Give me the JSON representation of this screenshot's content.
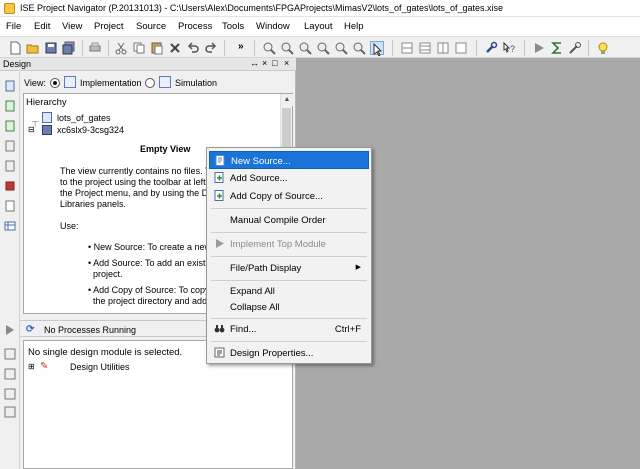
{
  "window": {
    "title": "ISE Project Navigator (P.20131013) - C:\\Users\\Alex\\Documents\\FPGAProjects\\MimasV2\\lots_of_gates\\lots_of_gates.xise"
  },
  "menubar": {
    "items": [
      "File",
      "Edit",
      "View",
      "Project",
      "Source",
      "Process",
      "Tools",
      "Window",
      "Layout",
      "Help"
    ]
  },
  "design_panel": {
    "title": "Design",
    "controls": [
      "↔",
      "×",
      "□",
      "×"
    ],
    "view_label": "View:",
    "view_options": [
      {
        "label": "Implementation",
        "selected": true
      },
      {
        "label": "Simulation",
        "selected": false
      }
    ],
    "hierarchy_label": "Hierarchy",
    "tree": [
      {
        "label": "lots_of_gates",
        "icon": "project-file-icon"
      },
      {
        "label": "xc6slx9-3csg324",
        "icon": "fpga-chip-icon"
      }
    ],
    "empty_view": {
      "heading": "Empty View",
      "lines": [
        "The view currently contains no files. Yo",
        "to the project using the toolbar at left,",
        "the Project menu, and by using the De",
        "Libraries panels."
      ],
      "use_label": "Use:",
      "bullets": [
        [
          "• New Source: To create a new"
        ],
        [
          "• Add Source: To add an existin",
          "project."
        ],
        [
          "• Add Copy of Source: To copy a",
          "the project directory and add"
        ]
      ]
    }
  },
  "processes_panel": {
    "status": "No Processes Running",
    "message": "No single design module is selected.",
    "item": "Design Utilities"
  },
  "context_menu": {
    "items": [
      {
        "label": "New Source...",
        "icon": "new-source-icon",
        "selected": true
      },
      {
        "label": "Add Source...",
        "icon": "add-source-icon"
      },
      {
        "label": "Add Copy of Source...",
        "icon": "add-copy-source-icon"
      },
      {
        "label": "Manual Compile Order"
      },
      {
        "label": "Implement Top Module",
        "icon": "run-arrow-icon",
        "disabled": true
      },
      {
        "label": "File/Path Display",
        "submenu": "▶"
      },
      {
        "label": "Expand All"
      },
      {
        "label": "Collapse All"
      },
      {
        "label": "Find...",
        "icon": "binoculars-icon",
        "shortcut": "Ctrl+F"
      },
      {
        "label": "Design Properties...",
        "icon": "properties-icon"
      }
    ]
  },
  "colors": {
    "workspace": "#a9a9a9",
    "menu_highlight": "#1a73d9",
    "panel_bg": "#f0f0f0"
  }
}
